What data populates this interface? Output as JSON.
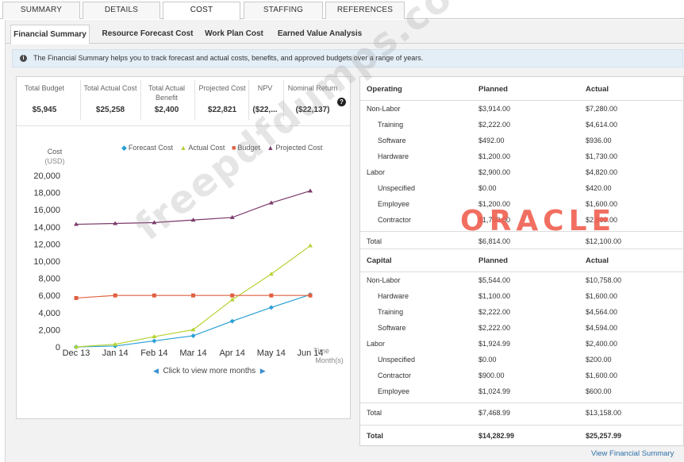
{
  "top_tabs": [
    {
      "label": "SUMMARY",
      "active": false
    },
    {
      "label": "DETAILS",
      "active": false
    },
    {
      "label": "COST",
      "active": true
    },
    {
      "label": "STAFFING",
      "active": false
    },
    {
      "label": "REFERENCES",
      "active": false
    }
  ],
  "sub_tabs": [
    {
      "label": "Financial Summary",
      "active": true
    },
    {
      "label": "Resource Forecast Cost",
      "active": false
    },
    {
      "label": "Work Plan Cost",
      "active": false
    },
    {
      "label": "Earned Value Analysis",
      "active": false
    }
  ],
  "info": {
    "icon": "info-icon",
    "text": "The Financial Summary helps you to track forecast and actual costs, benefits, and approved budgets over a range of years."
  },
  "kpis": [
    {
      "label": "Total Budget",
      "value": "$5,945"
    },
    {
      "label": "Total Actual Cost",
      "value": "$25,258"
    },
    {
      "label": "Total Actual Benefit",
      "value": "$2,400"
    },
    {
      "label": "Projected Cost",
      "value": "$22,821"
    },
    {
      "label": "NPV",
      "value": "($22,..."
    },
    {
      "label": "Nominal Return",
      "value": "($22,137)"
    }
  ],
  "chart_data": {
    "type": "line",
    "x": [
      "Dec 13",
      "Jan 14",
      "Feb 14",
      "Mar 14",
      "Apr 14",
      "May 14",
      "Jun 14"
    ],
    "series": [
      {
        "name": "Forecast Cost",
        "color": "#2a9fd6",
        "marker": "diamond",
        "values": [
          0,
          100,
          700,
          1300,
          3000,
          4600,
          6100
        ]
      },
      {
        "name": "Actual Cost",
        "color": "#b5d334",
        "marker": "triangle",
        "values": [
          0,
          300,
          1200,
          2000,
          5500,
          8500,
          11800
        ]
      },
      {
        "name": "Budget",
        "color": "#e06040",
        "marker": "square",
        "values": [
          5700,
          6000,
          6000,
          6000,
          6000,
          6000,
          6000
        ]
      },
      {
        "name": "Projected Cost",
        "color": "#7a3a6a",
        "marker": "triangle",
        "values": [
          14300,
          14400,
          14500,
          14800,
          15100,
          16800,
          18200
        ]
      }
    ],
    "ylabel": "Cost",
    "yunit": "(USD)",
    "xlabel_line1": "Time",
    "xlabel_line2": "Month(s)",
    "yticks": [
      "0",
      "2,000",
      "4,000",
      "6,000",
      "8,000",
      "10,000",
      "12,000",
      "14,000",
      "16,000",
      "18,000",
      "20,000"
    ],
    "ylim": [
      0,
      20000
    ],
    "legend_position": "top"
  },
  "more_months": {
    "label": "Click to view more months"
  },
  "operating": {
    "headers": [
      "Operating",
      "Planned",
      "Actual"
    ],
    "rows": [
      {
        "label": "Non-Labor",
        "planned": "$3,914.00",
        "actual": "$7,280.00",
        "indent": false
      },
      {
        "label": "Training",
        "planned": "$2,222.00",
        "actual": "$4,614.00",
        "indent": true
      },
      {
        "label": "Software",
        "planned": "$492.00",
        "actual": "$936.00",
        "indent": true
      },
      {
        "label": "Hardware",
        "planned": "$1,200.00",
        "actual": "$1,730.00",
        "indent": true
      },
      {
        "label": "Labor",
        "planned": "$2,900.00",
        "actual": "$4,820.00",
        "indent": false
      },
      {
        "label": "Unspecified",
        "planned": "$0.00",
        "actual": "$420.00",
        "indent": true
      },
      {
        "label": "Employee",
        "planned": "$1,200.00",
        "actual": "$1,600.00",
        "indent": true
      },
      {
        "label": "Contractor",
        "planned": "$1,700.00",
        "actual": "$2,800.00",
        "indent": true
      }
    ],
    "total": {
      "label": "Total",
      "planned": "$6,814.00",
      "actual": "$12,100.00"
    }
  },
  "capital": {
    "headers": [
      "Capital",
      "Planned",
      "Actual"
    ],
    "rows": [
      {
        "label": "Non-Labor",
        "planned": "$5,544.00",
        "actual": "$10,758.00",
        "indent": false
      },
      {
        "label": "Hardware",
        "planned": "$1,100.00",
        "actual": "$1,600.00",
        "indent": true
      },
      {
        "label": "Training",
        "planned": "$2,222.00",
        "actual": "$4,564.00",
        "indent": true
      },
      {
        "label": "Software",
        "planned": "$2,222.00",
        "actual": "$4,594.00",
        "indent": true
      },
      {
        "label": "Labor",
        "planned": "$1,924.99",
        "actual": "$2,400.00",
        "indent": false
      },
      {
        "label": "Unspecified",
        "planned": "$0.00",
        "actual": "$200.00",
        "indent": true
      },
      {
        "label": "Contractor",
        "planned": "$900.00",
        "actual": "$1,600.00",
        "indent": true
      },
      {
        "label": "Employee",
        "planned": "$1,024.99",
        "actual": "$600.00",
        "indent": true
      }
    ],
    "total": {
      "label": "Total",
      "planned": "$7,468.99",
      "actual": "$13,158.00"
    }
  },
  "grand_total": {
    "label": "Total",
    "planned": "$14,282.99",
    "actual": "$25,257.99"
  },
  "view_link": "View Financial Summary",
  "watermarks": {
    "brand": "ORACLE",
    "site": "freepdfdumps.com"
  }
}
